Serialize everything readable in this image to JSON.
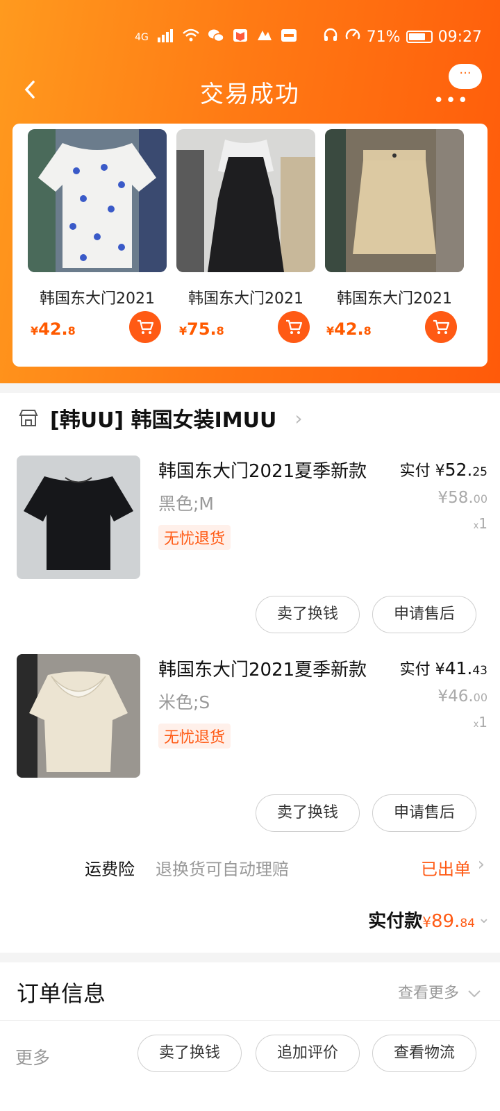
{
  "status_bar": {
    "network": "4G",
    "battery": "71%",
    "time": "09:27"
  },
  "nav": {
    "back_icon": "chevron-left-icon",
    "title": "交易成功",
    "more_icon": "more-dots-icon",
    "bubble": "···"
  },
  "recommendations": [
    {
      "name": "韩国东大门2021",
      "price_symbol": "¥",
      "price_int": "42.",
      "price_dec": "8"
    },
    {
      "name": "韩国东大门2021",
      "price_symbol": "¥",
      "price_int": "75.",
      "price_dec": "8"
    },
    {
      "name": "韩国东大门2021",
      "price_symbol": "¥",
      "price_int": "42.",
      "price_dec": "8"
    }
  ],
  "shop": {
    "name": "[韩UU] 韩国女装IMUU",
    "items": [
      {
        "name": "韩国东大门2021夏季新款",
        "spec": "黑色;M",
        "badge": "无忧退货",
        "paid_label": "实付",
        "paid_symbol": "¥",
        "paid_int": "52.",
        "paid_dec": "25",
        "orig_symbol": "¥",
        "orig_int": "58.",
        "orig_dec": "00",
        "qty_x": "x",
        "qty": "1",
        "sell_button": "卖了换钱",
        "aftersale_button": "申请售后"
      },
      {
        "name": "韩国东大门2021夏季新款",
        "spec": "米色;S",
        "badge": "无忧退货",
        "paid_label": "实付",
        "paid_symbol": "¥",
        "paid_int": "41.",
        "paid_dec": "43",
        "orig_symbol": "¥",
        "orig_int": "46.",
        "orig_dec": "00",
        "qty_x": "x",
        "qty": "1",
        "sell_button": "卖了换钱",
        "aftersale_button": "申请售后"
      }
    ],
    "insurance": {
      "label": "运费险",
      "desc": "退换货可自动理赔",
      "status": "已出单"
    },
    "total": {
      "label": "实付款",
      "symbol": "¥",
      "int": "89.",
      "dec": "84"
    }
  },
  "order_info": {
    "title": "订单信息",
    "more": "查看更多"
  },
  "bottom_bar": {
    "more": "更多",
    "buttons": [
      "卖了换钱",
      "追加评价",
      "查看物流"
    ]
  },
  "colors": {
    "accent": "#ff5a14",
    "header_start": "#ff9a1e",
    "header_end": "#ff5a0a"
  }
}
